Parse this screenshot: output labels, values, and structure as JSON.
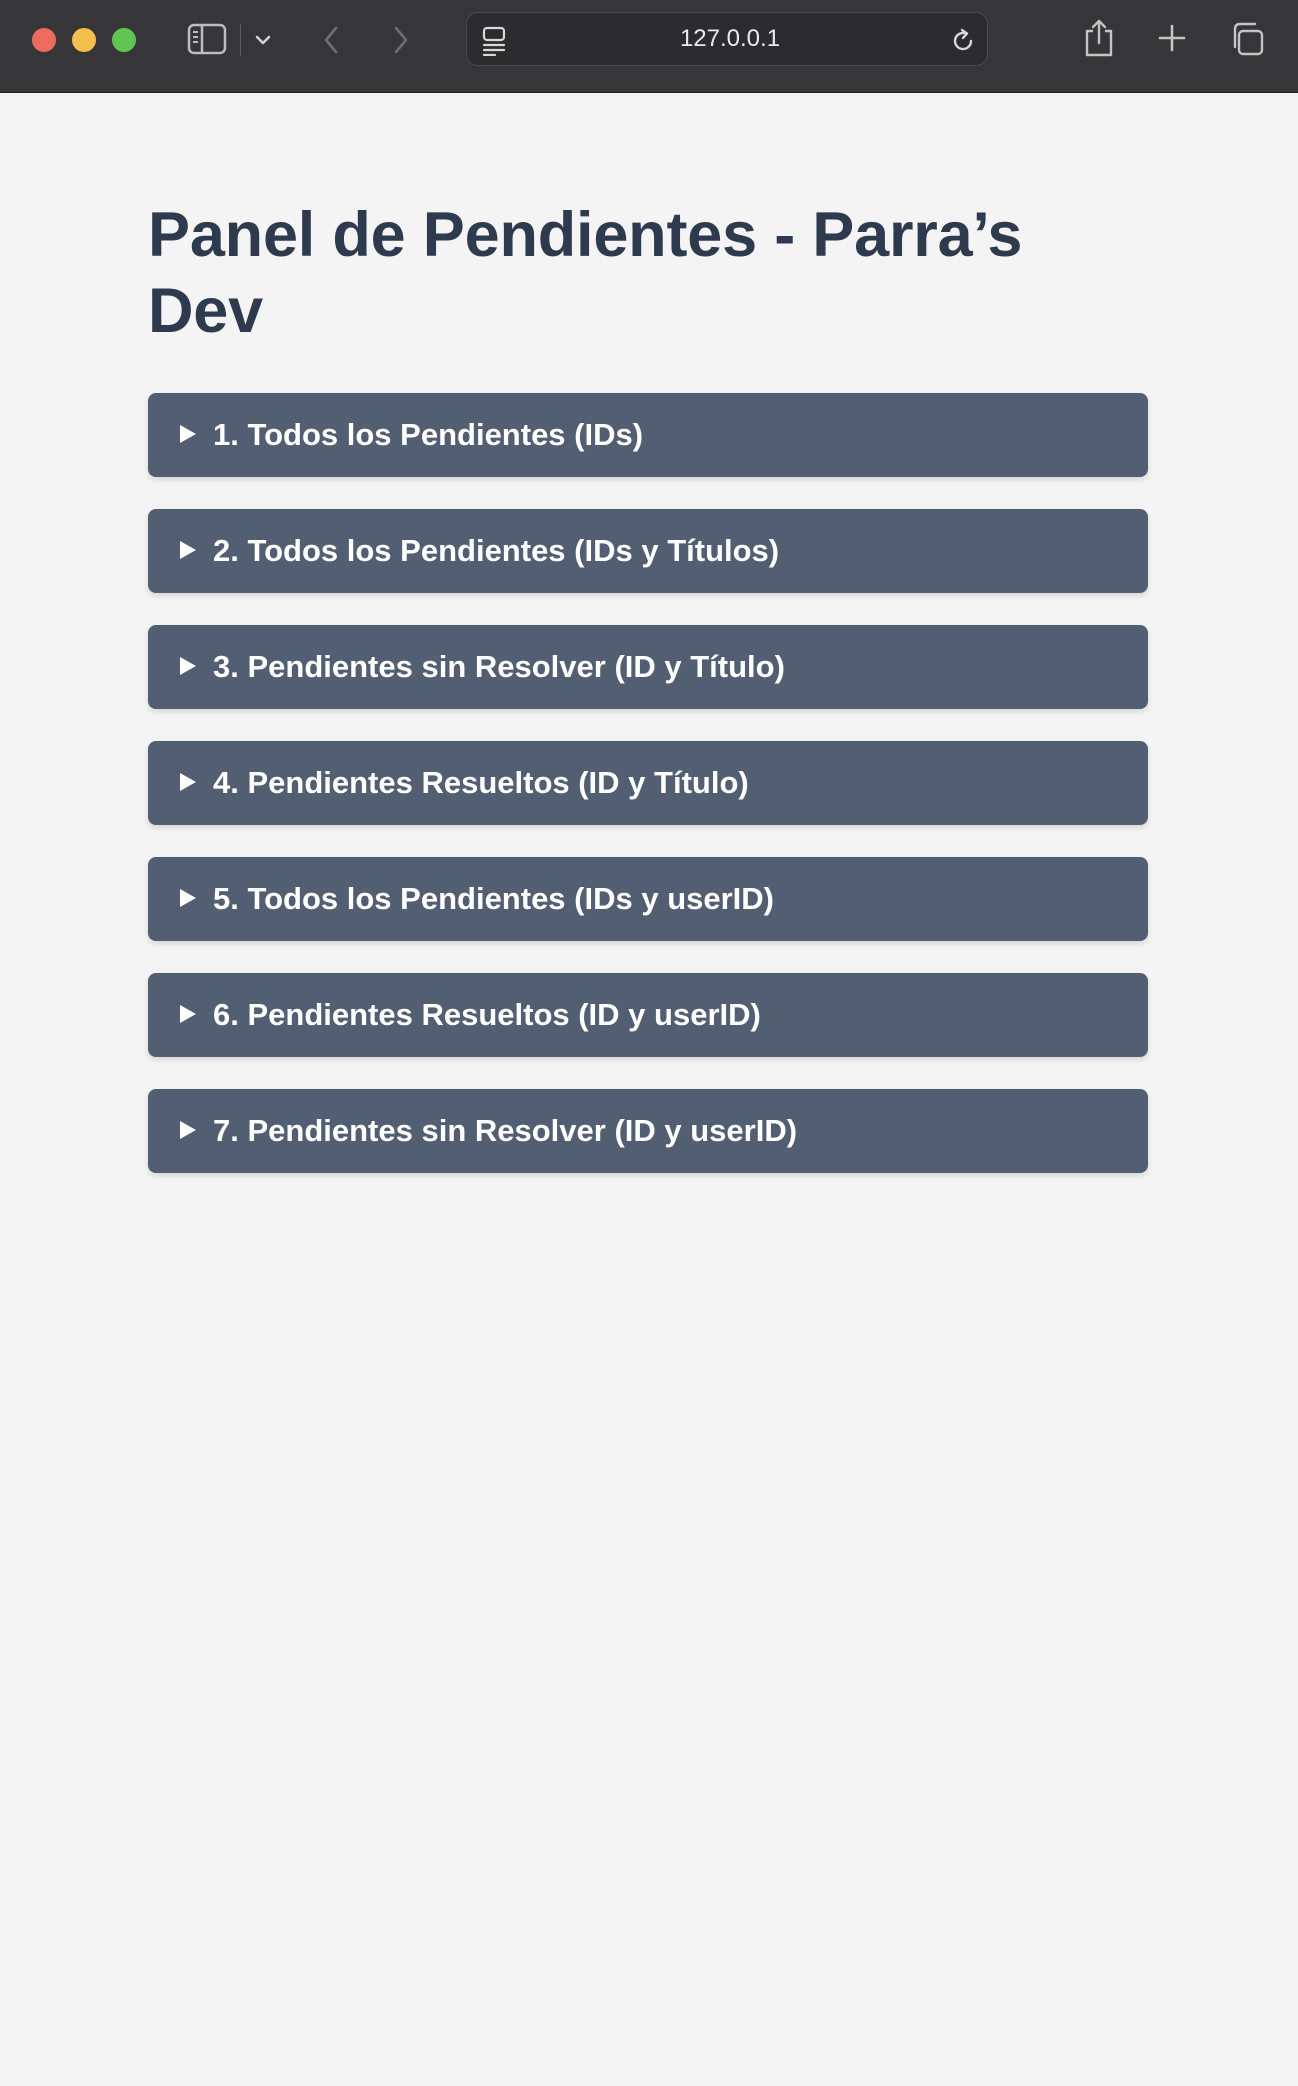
{
  "browser": {
    "address": "127.0.0.1",
    "icons": {
      "sidebar": "sidebar-icon",
      "chevron": "chevron-down-icon",
      "back": "back-arrow-icon",
      "forward": "forward-arrow-icon",
      "page": "page-menu-icon",
      "reload": "reload-icon",
      "share": "share-icon",
      "new_tab": "plus-icon",
      "tabs": "tab-overview-icon"
    }
  },
  "page": {
    "title": "Panel de Pendientes - Parra’s Dev",
    "sections": [
      {
        "label": "1. Todos los Pendientes (IDs)",
        "expanded": false
      },
      {
        "label": "2. Todos los Pendientes (IDs y Títulos)",
        "expanded": false
      },
      {
        "label": "3. Pendientes sin Resolver (ID y Título)",
        "expanded": false
      },
      {
        "label": "4. Pendientes Resueltos (ID y Título)",
        "expanded": false
      },
      {
        "label": "5. Todos los Pendientes (IDs y userID)",
        "expanded": false
      },
      {
        "label": "6. Pendientes Resueltos (ID y userID)",
        "expanded": false
      },
      {
        "label": "7. Pendientes sin Resolver (ID y userID)",
        "expanded": false
      }
    ]
  },
  "colors": {
    "background": "#f4f4f4",
    "title": "#2e3b4e",
    "section_bg": "#525e71",
    "section_text": "#ffffff",
    "toolbar": "#363638"
  }
}
